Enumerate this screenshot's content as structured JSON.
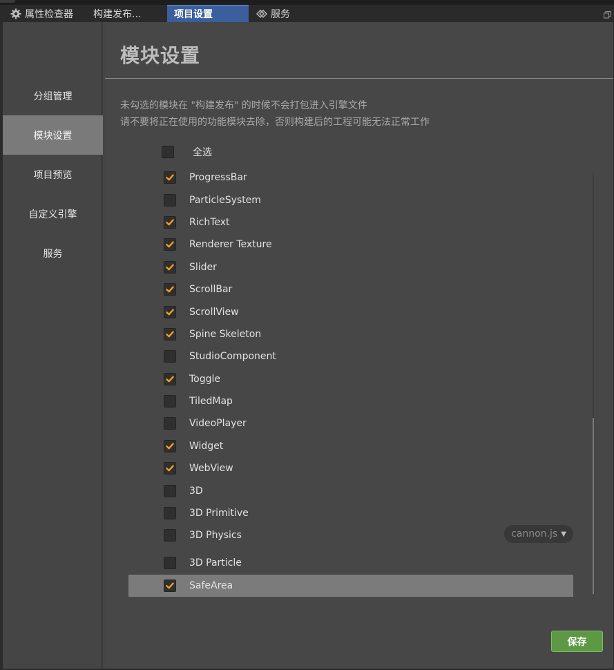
{
  "tabs": [
    {
      "label": "属性检查器",
      "icon": "gear-icon",
      "active": false
    },
    {
      "label": "构建发布...",
      "icon": "",
      "active": false
    },
    {
      "label": "项目设置",
      "icon": "",
      "active": true
    },
    {
      "label": "服务",
      "icon": "services-icon",
      "active": false
    }
  ],
  "sidebar": {
    "items": [
      {
        "label": "分组管理",
        "active": false
      },
      {
        "label": "模块设置",
        "active": true
      },
      {
        "label": "项目预览",
        "active": false
      },
      {
        "label": "自定义引擎",
        "active": false
      },
      {
        "label": "服务",
        "active": false
      }
    ]
  },
  "main": {
    "title": "模块设置",
    "notice_line1": "未勾选的模块在 \"构建发布\" 的时候不会打包进入引擎文件",
    "notice_line2": "请不要将正在使用的功能模块去除，否则构建后的工程可能无法正常工作",
    "select_all_label": "全选",
    "select_all_checked": false,
    "modules": [
      {
        "label": "ProgressBar",
        "checked": true
      },
      {
        "label": "ParticleSystem",
        "checked": false
      },
      {
        "label": "RichText",
        "checked": true
      },
      {
        "label": "Renderer Texture",
        "checked": true
      },
      {
        "label": "Slider",
        "checked": true
      },
      {
        "label": "ScrollBar",
        "checked": true
      },
      {
        "label": "ScrollView",
        "checked": true
      },
      {
        "label": "Spine Skeleton",
        "checked": true
      },
      {
        "label": "StudioComponent",
        "checked": false
      },
      {
        "label": "Toggle",
        "checked": true
      },
      {
        "label": "TiledMap",
        "checked": false
      },
      {
        "label": "VideoPlayer",
        "checked": false
      },
      {
        "label": "Widget",
        "checked": true
      },
      {
        "label": "WebView",
        "checked": true
      },
      {
        "label": "3D",
        "checked": false
      },
      {
        "label": "3D Primitive",
        "checked": false
      },
      {
        "label": "3D Physics",
        "checked": false,
        "dropdown": "cannon.js"
      },
      {
        "label": "3D Particle",
        "checked": false
      },
      {
        "label": "SafeArea",
        "checked": true,
        "highlighted": true
      }
    ],
    "physics_dropdown_value": "cannon.js",
    "save_label": "保存"
  },
  "colors": {
    "accent_tab": "#3b5e9c",
    "check_orange": "#f0a020",
    "save_green": "#5d9845"
  }
}
